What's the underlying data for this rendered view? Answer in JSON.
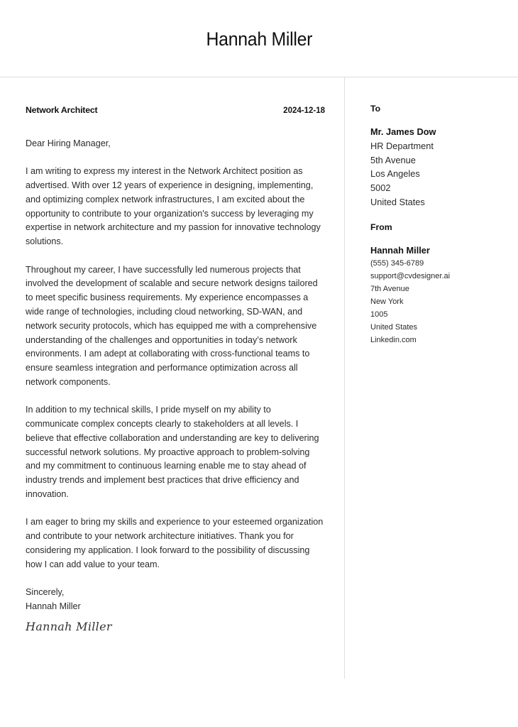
{
  "header": {
    "name": "Hannah Miller"
  },
  "letter": {
    "job_title": "Network Architect",
    "date": "2024-12-18",
    "greeting": "Dear Hiring Manager,",
    "paragraphs": [
      "I am writing to express my interest in the Network Architect position as advertised. With over 12 years of experience in designing, implementing, and optimizing complex network infrastructures, I am excited about the opportunity to contribute to your organization's success by leveraging my expertise in network architecture and my passion for innovative technology solutions.",
      "Throughout my career, I have successfully led numerous projects that involved the development of scalable and secure network designs tailored to meet specific business requirements. My experience encompasses a wide range of technologies, including cloud networking, SD-WAN, and network security protocols, which has equipped me with a comprehensive understanding of the challenges and opportunities in today’s network environments. I am adept at collaborating with cross-functional teams to ensure seamless integration and performance optimization across all network components.",
      "In addition to my technical skills, I pride myself on my ability to communicate complex concepts clearly to stakeholders at all levels. I believe that effective collaboration and understanding are key to delivering successful network solutions. My proactive approach to problem-solving and my commitment to continuous learning enable me to stay ahead of industry trends and implement best practices that drive efficiency and innovation.",
      "I am eager to bring my skills and experience to your esteemed organization and contribute to your network architecture initiatives. Thank you for considering my application. I look forward to the possibility of discussing how I can add value to your team."
    ],
    "closing": "Sincerely,",
    "closing_name": "Hannah Miller",
    "signature": "Hannah Miller"
  },
  "recipient": {
    "label": "To",
    "name": "Mr. James Dow",
    "lines": [
      "HR Department",
      "5th Avenue",
      "Los Angeles",
      "5002",
      "United States"
    ]
  },
  "sender": {
    "label": "From",
    "name": "Hannah Miller",
    "lines": [
      "(555) 345-6789",
      "support@cvdesigner.ai",
      "7th Avenue",
      "New York",
      "1005",
      "United States",
      "Linkedin.com"
    ]
  }
}
